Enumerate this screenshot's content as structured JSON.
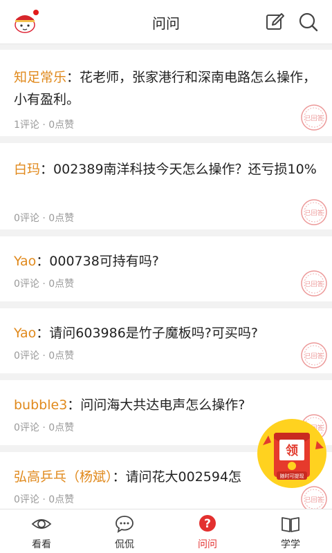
{
  "header": {
    "title": "问问"
  },
  "questions": [
    {
      "author": "知足常乐",
      "colon": "：",
      "text": "花老师，张家港行和深南电路怎么操作，小有盈利。",
      "meta": "1评论 · 0点赞",
      "stamp": "已回答"
    },
    {
      "author": "白玛",
      "colon": "：",
      "text": "002389南洋科技今天怎么操作？还亏损10%",
      "meta": "0评论 · 0点赞",
      "stamp": "已回答"
    },
    {
      "author": "Yao",
      "colon": "：",
      "text": "000738可持有吗?",
      "meta": "0评论 · 0点赞",
      "stamp": "已回答"
    },
    {
      "author": "Yao",
      "colon": "：",
      "text": "请问603986是竹子魔板吗?可买吗?",
      "meta": "0评论 · 0点赞",
      "stamp": "已回答"
    },
    {
      "author": "bubble3",
      "colon": "：",
      "text": "问问海大共达电声怎么操作?",
      "meta": "0评论 · 0点赞",
      "stamp": "已回答"
    },
    {
      "author": "弘高乒乓（杨斌）",
      "colon": "：",
      "text": "请问花大002594怎",
      "meta": "0评论 · 0点赞",
      "stamp": "已回答"
    }
  ],
  "envelope": {
    "char": "领",
    "caption": "随时可提现"
  },
  "tabs": [
    {
      "label": "看看",
      "icon": "eye-icon"
    },
    {
      "label": "侃侃",
      "icon": "chat-icon"
    },
    {
      "label": "问问",
      "icon": "question-icon",
      "active": true
    },
    {
      "label": "学学",
      "icon": "book-icon"
    }
  ],
  "colors": {
    "accent": "#e3302f",
    "author": "#e0891c",
    "meta": "#999999"
  }
}
